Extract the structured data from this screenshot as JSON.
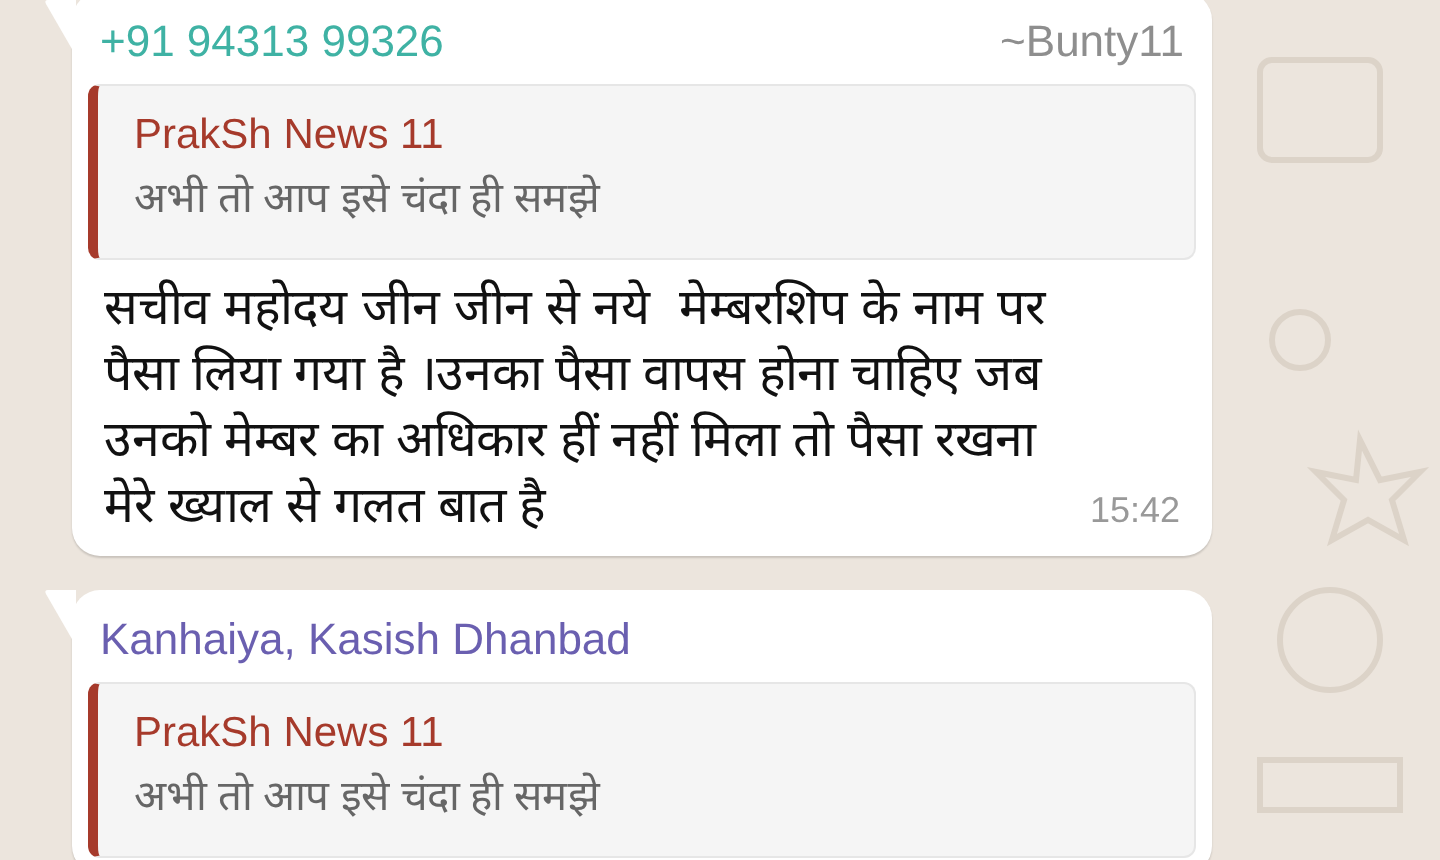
{
  "messages": [
    {
      "sender": "+91 94313 99326",
      "color": "#3fb2a4",
      "push_name": "~Bunty11",
      "quote": {
        "author": "PrakSh News 11",
        "text": "अभी तो आप इसे चंदा ही समझे"
      },
      "text": "सचीव महोदय जीन जीन से नये  मेम्बरशिप के नाम पर पैसा लिया गया है ।उनका पैसा वापस होना चाहिए जब उनको मेम्बर का अधिकार हीं नहीं मिला तो पैसा रखना मेरे ख्याल से गलत बात है",
      "time": "15:42"
    },
    {
      "sender": "Kanhaiya, Kasish Dhanbad",
      "color": "#6a5fb0",
      "quote": {
        "author": "PrakSh News 11",
        "text": "अभी तो आप इसे चंदा ही समझे"
      }
    }
  ]
}
